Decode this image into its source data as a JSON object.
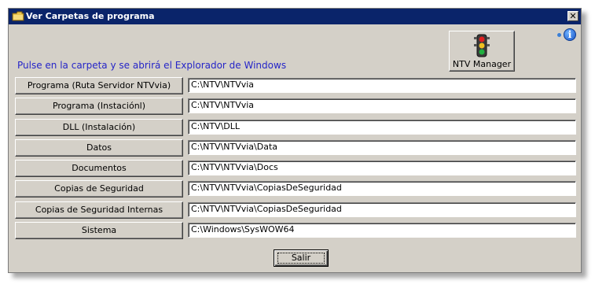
{
  "window": {
    "title": "Ver Carpetas de programa",
    "close_label": "✕",
    "title_icon": "folder-icon"
  },
  "header": {
    "instruction": "Pulse en la carpeta y se abrirá el Explorador de Windows",
    "ntv_manager_label": "NTV Manager",
    "ntv_manager_icon": "traffic-light-icon",
    "info_icon": "info-icon"
  },
  "rows": [
    {
      "label": "Programa (Ruta Servidor NTVvia)",
      "path": "C:\\NTV\\NTVvia"
    },
    {
      "label": "Programa (Instaciónl)",
      "path": "C:\\NTV\\NTVvia"
    },
    {
      "label": "DLL (Instalación)",
      "path": "C:\\NTV\\DLL"
    },
    {
      "label": "Datos",
      "path": "C:\\NTV\\NTVvia\\Data"
    },
    {
      "label": "Documentos",
      "path": "C:\\NTV\\NTVvia\\Docs"
    },
    {
      "label": "Copias de Seguridad",
      "path": "C:\\NTV\\NTVvia\\CopiasDeSeguridad"
    },
    {
      "label": "Copias de Seguridad Internas",
      "path": "C:\\NTV\\NTVvia\\CopiasDeSeguridad"
    },
    {
      "label": "Sistema",
      "path": "C:\\Windows\\SysWOW64"
    }
  ],
  "footer": {
    "exit_label": "Salir"
  },
  "colors": {
    "titlebar": "#0a246a",
    "face": "#d4d0c8",
    "instruction_text": "#2525c8"
  }
}
